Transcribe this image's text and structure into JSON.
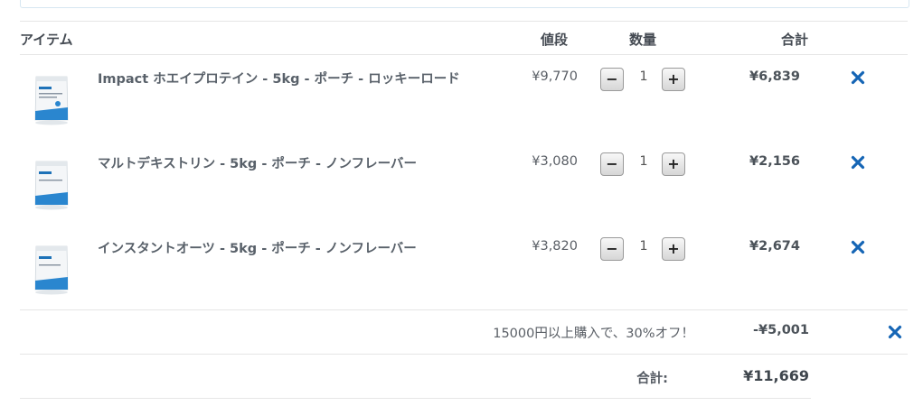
{
  "colors": {
    "accent": "#1565b5",
    "border": "#e6e6e6"
  },
  "table": {
    "headers": {
      "item": "アイテム",
      "price": "値段",
      "quantity": "数量",
      "subtotal": "合計"
    }
  },
  "items": [
    {
      "name": "Impact ホエイプロテイン - 5kg - ポーチ - ロッキーロード",
      "price": "¥9,770",
      "qty": "1",
      "total": "¥6,839",
      "icon": "product-pouch-icon"
    },
    {
      "name": "マルトデキストリン - 5kg - ポーチ - ノンフレーバー",
      "price": "¥3,080",
      "qty": "1",
      "total": "¥2,156",
      "icon": "product-pouch-icon"
    },
    {
      "name": "インスタントオーツ - 5kg - ポーチ - ノンフレーバー",
      "price": "¥3,820",
      "qty": "1",
      "total": "¥2,674",
      "icon": "product-pouch-icon"
    }
  ],
  "controls": {
    "minus": "−",
    "plus": "+",
    "remove_icon": "close-x-icon"
  },
  "discount": {
    "label": "15000円以上購入で、30%オフ！",
    "amount": "-¥5,001"
  },
  "total": {
    "label": "合計:",
    "amount": "¥11,669"
  }
}
